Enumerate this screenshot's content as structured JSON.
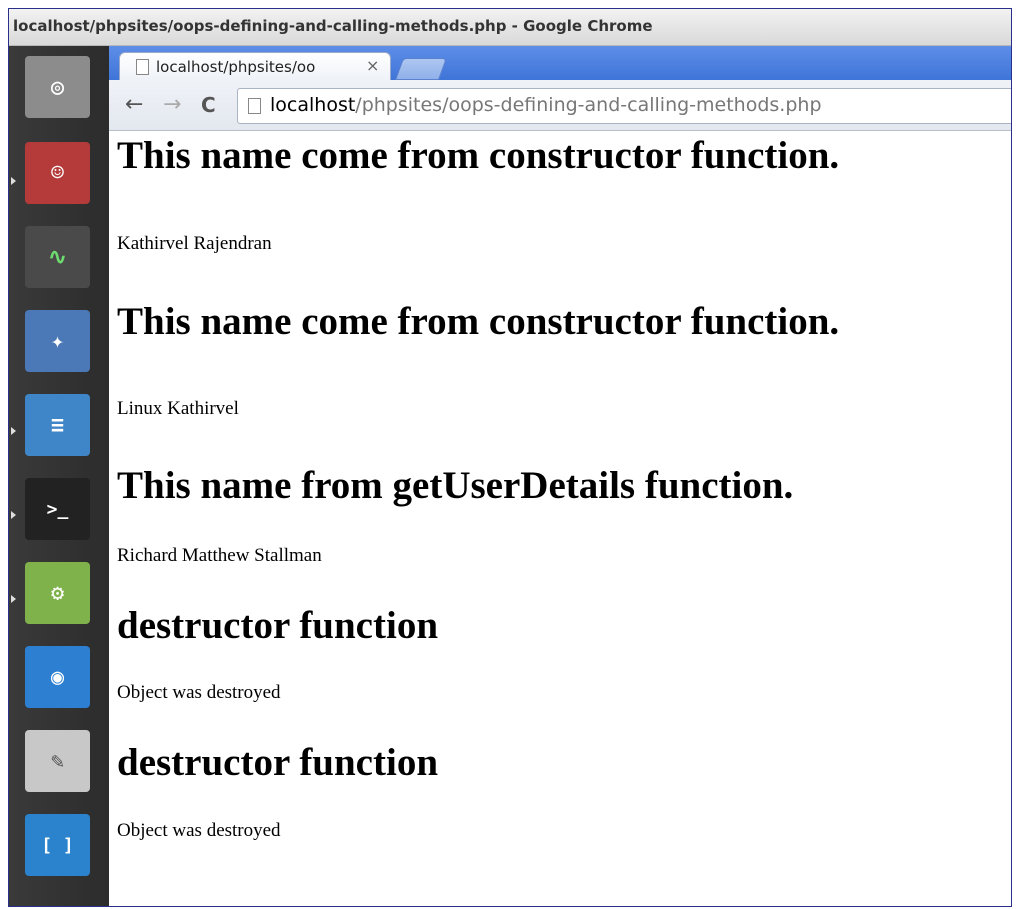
{
  "window": {
    "title": "localhost/phpsites/oops-defining-and-calling-methods.php - Google Chrome"
  },
  "launcher": {
    "items": [
      {
        "name": "ubuntu-home-icon",
        "glyph": "◎",
        "color": "#7a7a7a"
      },
      {
        "name": "files-finder-icon",
        "glyph": "☺",
        "color": "#b53b3b"
      },
      {
        "name": "system-monitor-icon",
        "glyph": "∿",
        "color": "#4a4a4a"
      },
      {
        "name": "safari-compass-icon",
        "glyph": "✦",
        "color": "#4b79b8"
      },
      {
        "name": "writer-document-icon",
        "glyph": "≡",
        "color": "#3f86c8"
      },
      {
        "name": "terminal-icon",
        "glyph": ">_",
        "color": "#333333"
      },
      {
        "name": "binary-settings-icon",
        "glyph": "⚙",
        "color": "#7fb24a"
      },
      {
        "name": "camera-icon",
        "glyph": "◉",
        "color": "#2d7fd1"
      },
      {
        "name": "text-editor-icon",
        "glyph": "✎",
        "color": "#c8c8c8"
      },
      {
        "name": "brackets-icon",
        "glyph": "[ ]",
        "color": "#2a83cc"
      }
    ]
  },
  "tab": {
    "label": "localhost/phpsites/oo",
    "close": "×"
  },
  "toolbar": {
    "back": "←",
    "forward": "→",
    "reload": "C"
  },
  "address": {
    "host": "localhost",
    "path": "/phpsites/oops-defining-and-calling-methods.php"
  },
  "content": {
    "heading1": "This name come from constructor function.",
    "name1": "Kathirvel Rajendran",
    "heading2": "This name come from constructor function.",
    "name2": "Linux Kathirvel",
    "heading3": "This name from getUserDetails function.",
    "name3": "Richard Matthew Stallman",
    "heading4": "destructor function",
    "message1": "Object was destroyed",
    "heading5": "destructor function",
    "message2": "Object was destroyed"
  }
}
